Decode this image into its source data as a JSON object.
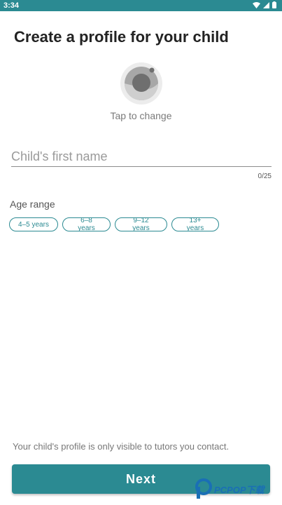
{
  "status_bar": {
    "time": "3:34"
  },
  "page": {
    "title": "Create a profile for your child",
    "avatar": {
      "icon": "avatar-camera-icon",
      "tap_label": "Tap to change"
    },
    "name_field": {
      "placeholder": "Child's first name",
      "value": "",
      "counter": "0/25"
    },
    "age_range": {
      "label": "Age range",
      "options": [
        "4–5 years",
        "6–8 years",
        "9–12 years",
        "13+ years"
      ]
    },
    "privacy_note": "Your child's profile is only visible to tutors you contact.",
    "next_label": "Next"
  },
  "watermark": {
    "text": "PCPOP下载"
  },
  "colors": {
    "accent": "#2b8a92",
    "status_bar": "#2b8a92"
  }
}
